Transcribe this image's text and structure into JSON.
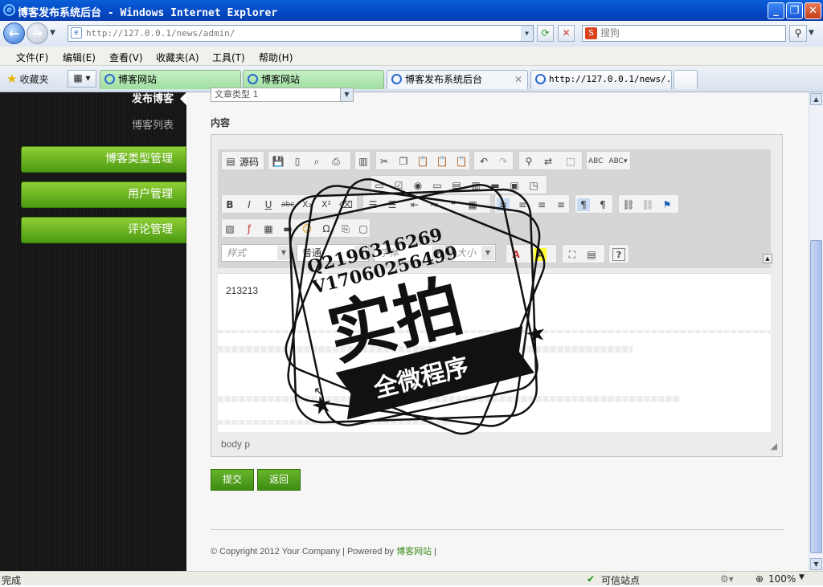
{
  "window": {
    "title": "博客发布系统后台 - Windows Internet Explorer"
  },
  "address": {
    "url": "http://127.0.0.1/news/admin/",
    "search_placeholder": "搜狗"
  },
  "menu": [
    "文件(F)",
    "编辑(E)",
    "查看(V)",
    "收藏夹(A)",
    "工具(T)",
    "帮助(H)"
  ],
  "favorites_label": "收藏夹",
  "tabs": [
    {
      "label": "博客网站"
    },
    {
      "label": "博客网站"
    },
    {
      "label": "博客发布系统后台"
    },
    {
      "label": "http://127.0.0.1/news/..."
    }
  ],
  "sidebar": {
    "active": "发布博客",
    "sub": "博客列表",
    "buttons": [
      "博客类型管理",
      "用户管理",
      "评论管理"
    ]
  },
  "form": {
    "select_value": "文章类型 1",
    "content_label": "内容",
    "source_label": "源码",
    "style_combo": "样式",
    "format_combo": "普通",
    "font_combo": "字体",
    "size_combo": "大小",
    "editor_text": "213213",
    "path": "body  p",
    "submit": "提交",
    "back": "返回"
  },
  "footer": {
    "copyright": "© Copyright 2012 Your Company | Powered by ",
    "link": "博客网站",
    "sep": " |"
  },
  "status": {
    "left": "完成",
    "zone": "可信站点",
    "zoom": "100%"
  },
  "watermark": {
    "qq": "Q2196316269",
    "v": "V17060256499",
    "big": "实拍",
    "banner": "全微程序"
  }
}
